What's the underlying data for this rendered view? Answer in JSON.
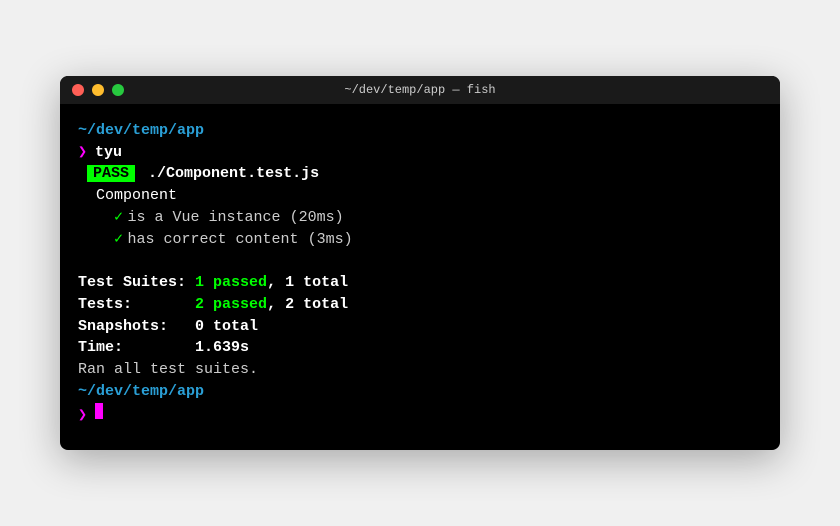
{
  "window": {
    "title": "~/dev/temp/app — fish"
  },
  "session": {
    "cwd": "~/dev/temp/app",
    "prompt": "❯",
    "command": "tyu"
  },
  "run": {
    "badge": "PASS",
    "file": "./Component.test.js",
    "suite": "Component",
    "tests": [
      {
        "check": "✓",
        "name": "is a Vue instance",
        "time": "(20ms)"
      },
      {
        "check": "✓",
        "name": "has correct content",
        "time": "(3ms)"
      }
    ]
  },
  "summary": {
    "suites_label": "Test Suites:",
    "suites_passed": "1 passed",
    "suites_total": ", 1 total",
    "tests_label": "Tests:      ",
    "tests_passed": "2 passed",
    "tests_total": ", 2 total",
    "snapshots_label": "Snapshots:  ",
    "snapshots_value": "0 total",
    "time_label": "Time:       ",
    "time_value": "1.639s",
    "ran": "Ran all test suites."
  }
}
